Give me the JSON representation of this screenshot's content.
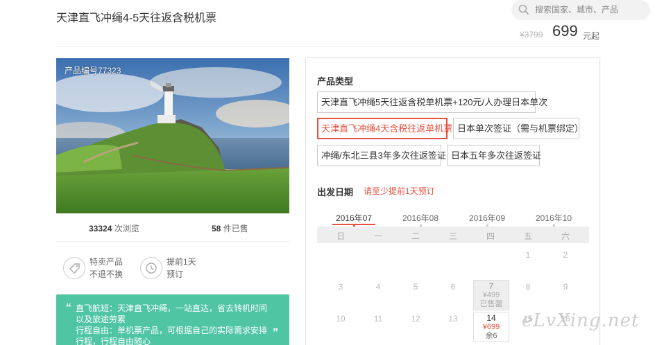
{
  "header": {
    "title": "天津直飞冲绳4-5天往返含税机票",
    "search_placeholder": "搜索国家、城市、产品",
    "old_price": "¥3799",
    "price": "699",
    "price_unit": "元起"
  },
  "product": {
    "number_label": "产品编号77323",
    "views_count": "33324",
    "views_label": "次浏览",
    "sold_count": "58",
    "sold_label": "件已售",
    "features": [
      {
        "icon": "tag-icon",
        "line1": "特卖产品",
        "line2": "不退不换"
      },
      {
        "icon": "clock-icon",
        "line1": "提前1天",
        "line2": "预订"
      }
    ],
    "highlights": [
      "直飞航班：天津直飞冲绳，一站直达，省去转机时间",
      "以及旅途劳累",
      "行程自由：单机票产品，可根据自己的实际需求安排",
      "行程，行程自由随心"
    ]
  },
  "booking": {
    "type_label": "产品类型",
    "options": [
      {
        "label": "天津直飞冲绳5天往返含税单机票+120元/人办理日本单次",
        "selected": false
      },
      {
        "label": "天津直飞冲绳4天含税往返单机票",
        "selected": true
      },
      {
        "label": "日本单次签证（需与机票绑定）",
        "selected": false
      },
      {
        "label": "冲绳/东北三县3年多次往返签证",
        "selected": false
      },
      {
        "label": "日本五年多次往返签证",
        "selected": false
      }
    ],
    "date_label": "出发日期",
    "date_note": "请至少提前1天预订",
    "months": [
      "2016年07",
      "2016年08",
      "2016年09",
      "2016年10"
    ],
    "weekdays": [
      "日",
      "一",
      "二",
      "三",
      "四",
      "五",
      "六"
    ],
    "row1": [
      "1",
      "2"
    ],
    "row2": [
      "3",
      "4",
      "5",
      "6",
      "7",
      "8",
      "9"
    ],
    "row3": [
      "10",
      "11",
      "12",
      "13",
      "14",
      "15",
      "16"
    ],
    "cell_7": {
      "day": "7",
      "price": "¥499",
      "status": "已售罄"
    },
    "cell_14": {
      "day": "14",
      "price": "¥699",
      "status": "余6"
    }
  },
  "watermark": "eLvXing.net",
  "colors": {
    "accent": "#e8503f",
    "green": "#4fc5a3"
  }
}
